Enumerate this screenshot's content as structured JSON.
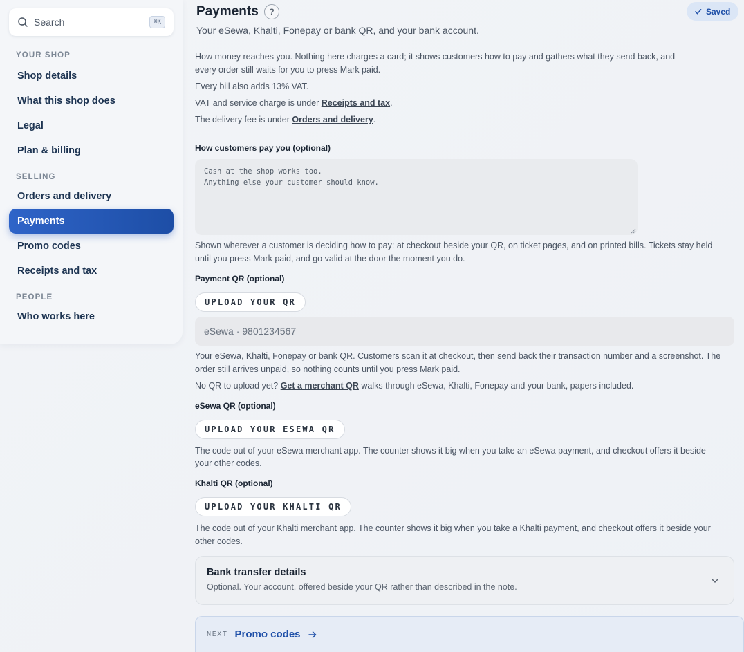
{
  "search": {
    "label": "Search",
    "shortcut": "⌘K"
  },
  "sidebar": {
    "sections": [
      {
        "title": "YOUR SHOP",
        "items": [
          "Shop details",
          "What this shop does",
          "Legal",
          "Plan & billing"
        ]
      },
      {
        "title": "SELLING",
        "items": [
          "Orders and delivery",
          "Payments",
          "Promo codes",
          "Receipts and tax"
        ]
      },
      {
        "title": "PEOPLE",
        "items": [
          "Who works here"
        ]
      }
    ],
    "active": "Payments"
  },
  "header": {
    "title": "Payments",
    "help": "?",
    "saved": "Saved",
    "subtitle": "Your eSewa, Khalti, Fonepay or bank QR, and your bank account."
  },
  "intro": {
    "line1": "How money reaches you. Nothing here charges a card; it shows customers how to pay and gathers what they send back, and",
    "line2": "every order still waits for you to press Mark paid.",
    "vat": "Every bill also adds 13% VAT.",
    "vat_link_pre": "VAT and service charge is under ",
    "vat_link": "Receipts and tax",
    "vat_link_post": ".",
    "delivery_pre": "The delivery fee is under ",
    "delivery_link": "Orders and delivery",
    "delivery_post": "."
  },
  "how_pay": {
    "label": "How customers pay you (optional)",
    "placeholder": "Cash at the shop works too.\nAnything else your customer should know.",
    "help_line1": "Shown wherever a customer is deciding how to pay: at checkout beside your QR, on ticket pages, and on printed bills. Tickets stay held",
    "help_line2": "until you press Mark paid, and go valid at the door the moment you do."
  },
  "payment_qr": {
    "label": "Payment QR (optional)",
    "upload": "UPLOAD YOUR QR",
    "field_placeholder": "eSewa · 9801234567",
    "help_line1": "Your eSewa, Khalti, Fonepay or bank QR. Customers scan it at checkout, then send back their transaction number and a screenshot. The",
    "help_line2": "order still arrives unpaid, so nothing counts until you press Mark paid.",
    "noqr_pre": "No QR to upload yet? ",
    "noqr_link": "Get a merchant QR",
    "noqr_post": " walks through eSewa, Khalti, Fonepay and your bank, papers included."
  },
  "esewa": {
    "label": "eSewa QR (optional)",
    "upload": "UPLOAD YOUR ESEWA QR",
    "help_line1": "The code out of your eSewa merchant app. The counter shows it big when you take an eSewa payment, and checkout offers it beside",
    "help_line2": "your other codes."
  },
  "khalti": {
    "label": "Khalti QR (optional)",
    "upload": "UPLOAD YOUR KHALTI QR",
    "help_line1": "The code out of your Khalti merchant app. The counter shows it big when you take a Khalti payment, and checkout offers it beside your",
    "help_line2": "other codes."
  },
  "bank": {
    "title": "Bank transfer details",
    "desc": "Optional. Your account, offered beside your QR rather than described in the note."
  },
  "next": {
    "tag": "NEXT",
    "label": "Promo codes"
  }
}
